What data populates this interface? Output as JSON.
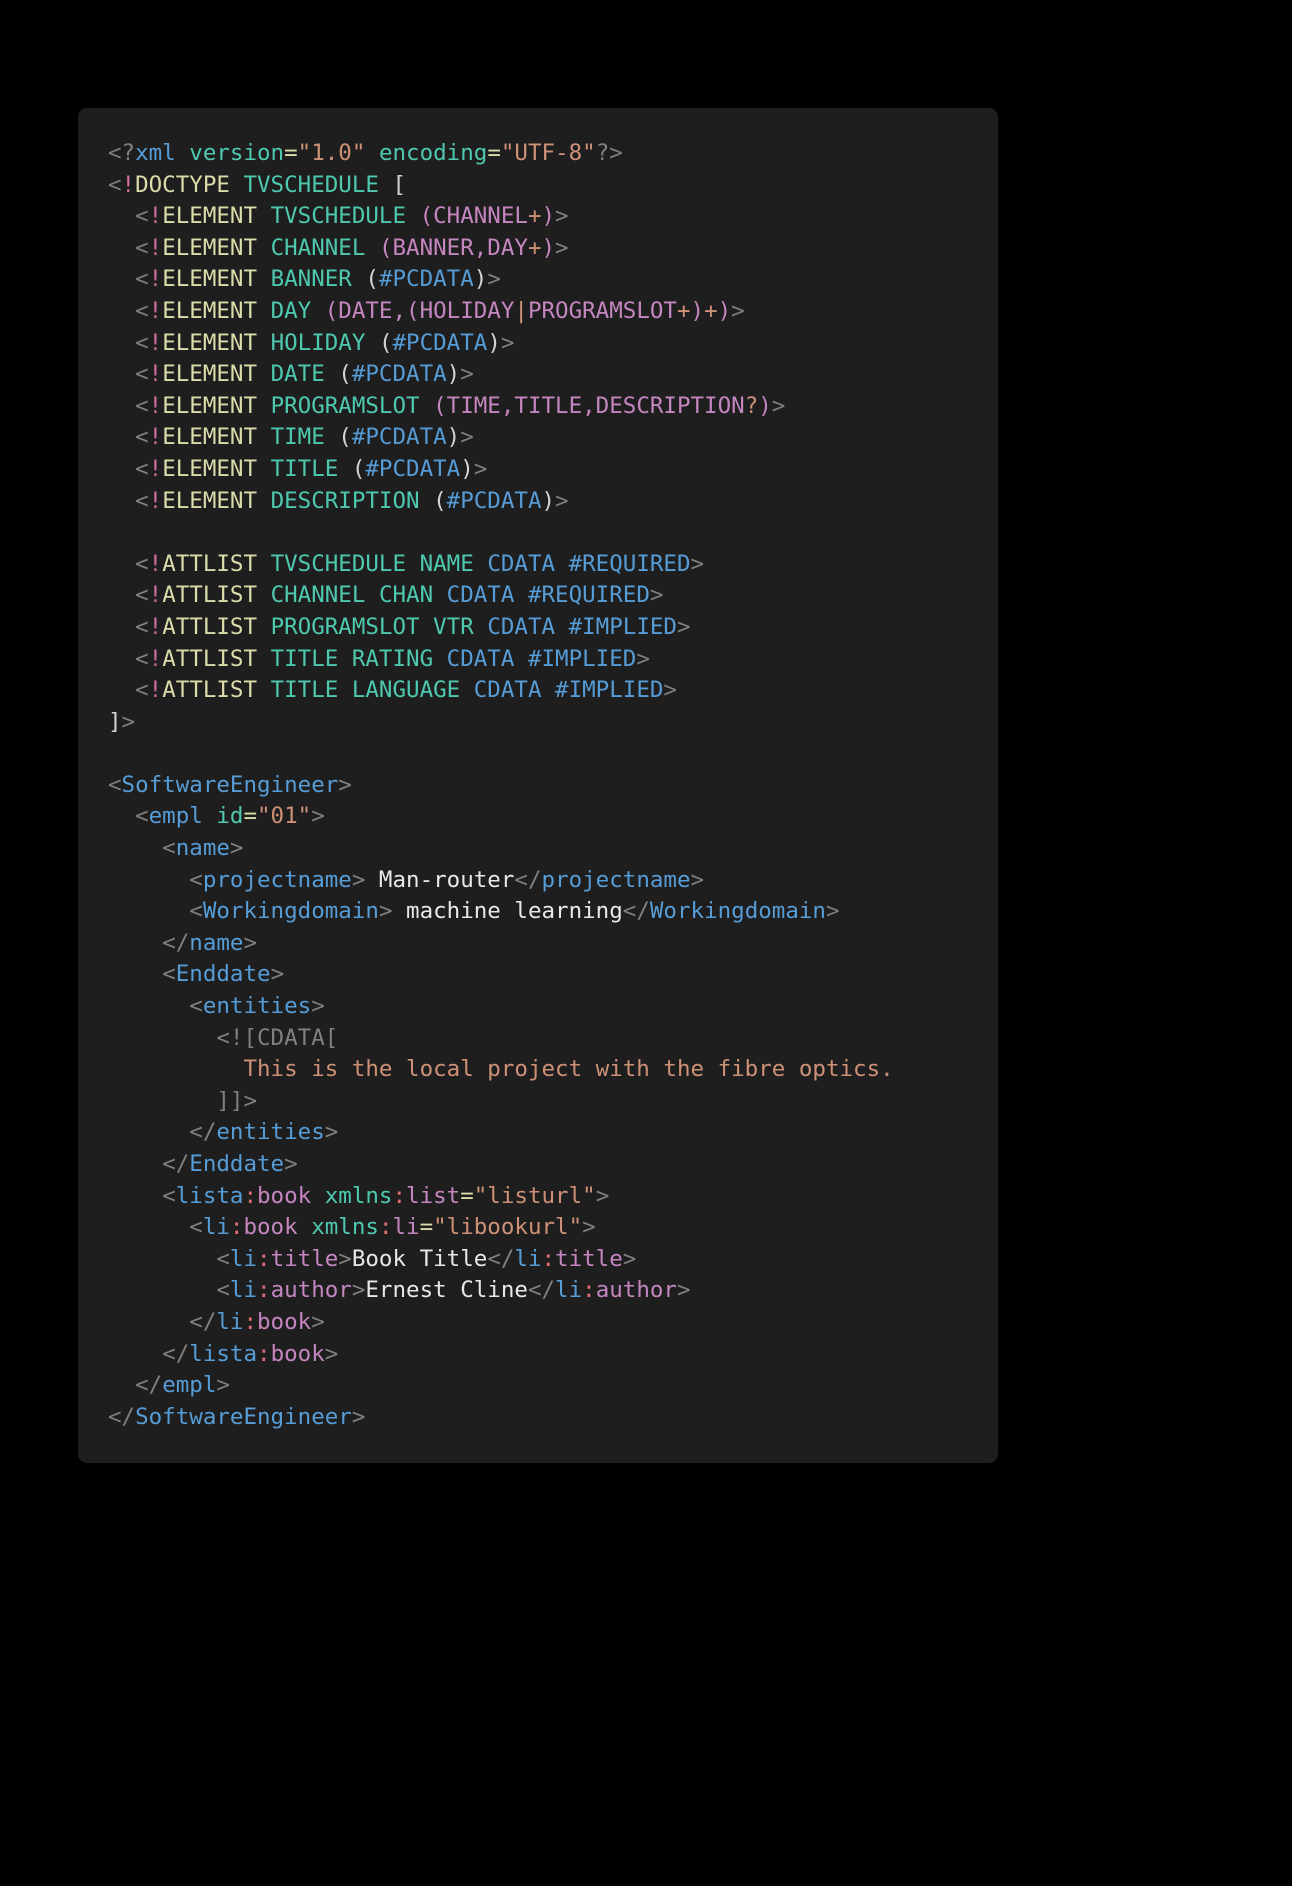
{
  "editor": {
    "background": "#1e1e1e",
    "page_background": "#000000",
    "language": "xml"
  },
  "colors": {
    "punctuation": "#808080",
    "bang": "#d16d9e",
    "keyword": "#dcdcaa",
    "element_name": "#4ec9b0",
    "content_model": "#c586c0",
    "pcdata": "#569cd6",
    "operator": "#ce9178",
    "plain": "#d4d4d4",
    "tag": "#569cd6",
    "ns_colon": "#e06c75",
    "ns_local": "#c586c0",
    "attr_value": "#ce9178",
    "text_content": "#e8e8e8",
    "cdata_marker": "#808080"
  },
  "code": {
    "lines": [
      "<?xml version=\"1.0\" encoding=\"UTF-8\"?>",
      "<!DOCTYPE TVSCHEDULE [",
      "  <!ELEMENT TVSCHEDULE (CHANNEL+)>",
      "  <!ELEMENT CHANNEL (BANNER,DAY+)>",
      "  <!ELEMENT BANNER (#PCDATA)>",
      "  <!ELEMENT DAY (DATE,(HOLIDAY|PROGRAMSLOT+)+)>",
      "  <!ELEMENT HOLIDAY (#PCDATA)>",
      "  <!ELEMENT DATE (#PCDATA)>",
      "  <!ELEMENT PROGRAMSLOT (TIME,TITLE,DESCRIPTION?)>",
      "  <!ELEMENT TIME (#PCDATA)>",
      "  <!ELEMENT TITLE (#PCDATA)>",
      "  <!ELEMENT DESCRIPTION (#PCDATA)>",
      "",
      "  <!ATTLIST TVSCHEDULE NAME CDATA #REQUIRED>",
      "  <!ATTLIST CHANNEL CHAN CDATA #REQUIRED>",
      "  <!ATTLIST PROGRAMSLOT VTR CDATA #IMPLIED>",
      "  <!ATTLIST TITLE RATING CDATA #IMPLIED>",
      "  <!ATTLIST TITLE LANGUAGE CDATA #IMPLIED>",
      "]>",
      "",
      "<SoftwareEngineer>",
      "  <empl id=\"01\">",
      "    <name>",
      "      <projectname> Man-router</projectname>",
      "      <Workingdomain> machine learning</Workingdomain>",
      "    </name>",
      "    <Enddate>",
      "      <entities>",
      "        <![CDATA[",
      "          This is the local project with the fibre optics.",
      "        ]]>",
      "      </entities>",
      "    </Enddate>",
      "    <lista:book xmlns:list=\"listurl\">",
      "      <li:book xmlns:li=\"libookurl\">",
      "        <li:title>Book Title</li:title>",
      "        <li:author>Ernest Cline</li:author>",
      "      </li:book>",
      "    </lista:book>",
      "  </empl>",
      "</SoftwareEngineer>"
    ],
    "prolog": {
      "version_attr": "version",
      "version_value": "\"1.0\"",
      "encoding_attr": "encoding",
      "encoding_value": "\"UTF-8\""
    },
    "doctype": {
      "keyword": "DOCTYPE",
      "root": "TVSCHEDULE"
    },
    "dtd_elements": [
      {
        "name": "TVSCHEDULE",
        "model": "(CHANNEL+)"
      },
      {
        "name": "CHANNEL",
        "model": "(BANNER,DAY+)"
      },
      {
        "name": "BANNER",
        "model": "(#PCDATA)"
      },
      {
        "name": "DAY",
        "model": "(DATE,(HOLIDAY|PROGRAMSLOT+)+)"
      },
      {
        "name": "HOLIDAY",
        "model": "(#PCDATA)"
      },
      {
        "name": "DATE",
        "model": "(#PCDATA)"
      },
      {
        "name": "PROGRAMSLOT",
        "model": "(TIME,TITLE,DESCRIPTION?)"
      },
      {
        "name": "TIME",
        "model": "(#PCDATA)"
      },
      {
        "name": "TITLE",
        "model": "(#PCDATA)"
      },
      {
        "name": "DESCRIPTION",
        "model": "(#PCDATA)"
      }
    ],
    "dtd_attlists": [
      {
        "element": "TVSCHEDULE",
        "attribute": "NAME",
        "type": "CDATA",
        "default": "#REQUIRED"
      },
      {
        "element": "CHANNEL",
        "attribute": "CHAN",
        "type": "CDATA",
        "default": "#REQUIRED"
      },
      {
        "element": "PROGRAMSLOT",
        "attribute": "VTR",
        "type": "CDATA",
        "default": "#IMPLIED"
      },
      {
        "element": "TITLE",
        "attribute": "RATING",
        "type": "CDATA",
        "default": "#IMPLIED"
      },
      {
        "element": "TITLE",
        "attribute": "LANGUAGE",
        "type": "CDATA",
        "default": "#IMPLIED"
      }
    ],
    "document": {
      "root_tag": "SoftwareEngineer",
      "empl_tag": "empl",
      "empl_id_attr": "id",
      "empl_id_value": "\"01\"",
      "name_tag": "name",
      "projectname_tag": "projectname",
      "projectname_text": " Man-router",
      "workingdomain_tag": "Workingdomain",
      "workingdomain_text": " machine learning",
      "enddate_tag": "Enddate",
      "entities_tag": "entities",
      "cdata_open": "<![CDATA[",
      "cdata_text": "This is the local project with the fibre optics.",
      "cdata_close": "]]>",
      "lista_prefix": "lista",
      "lista_local": "book",
      "lista_xmlns_attr": "xmlns",
      "lista_xmlns_prefix": "list",
      "lista_xmlns_value": "\"listurl\"",
      "li_prefix": "li",
      "li_local": "book",
      "li_xmlns_attr": "xmlns",
      "li_xmlns_prefix": "li",
      "li_xmlns_value": "\"libookurl\"",
      "li_title_local": "title",
      "li_title_text": "Book Title",
      "li_author_local": "author",
      "li_author_text": "Ernest Cline"
    }
  }
}
